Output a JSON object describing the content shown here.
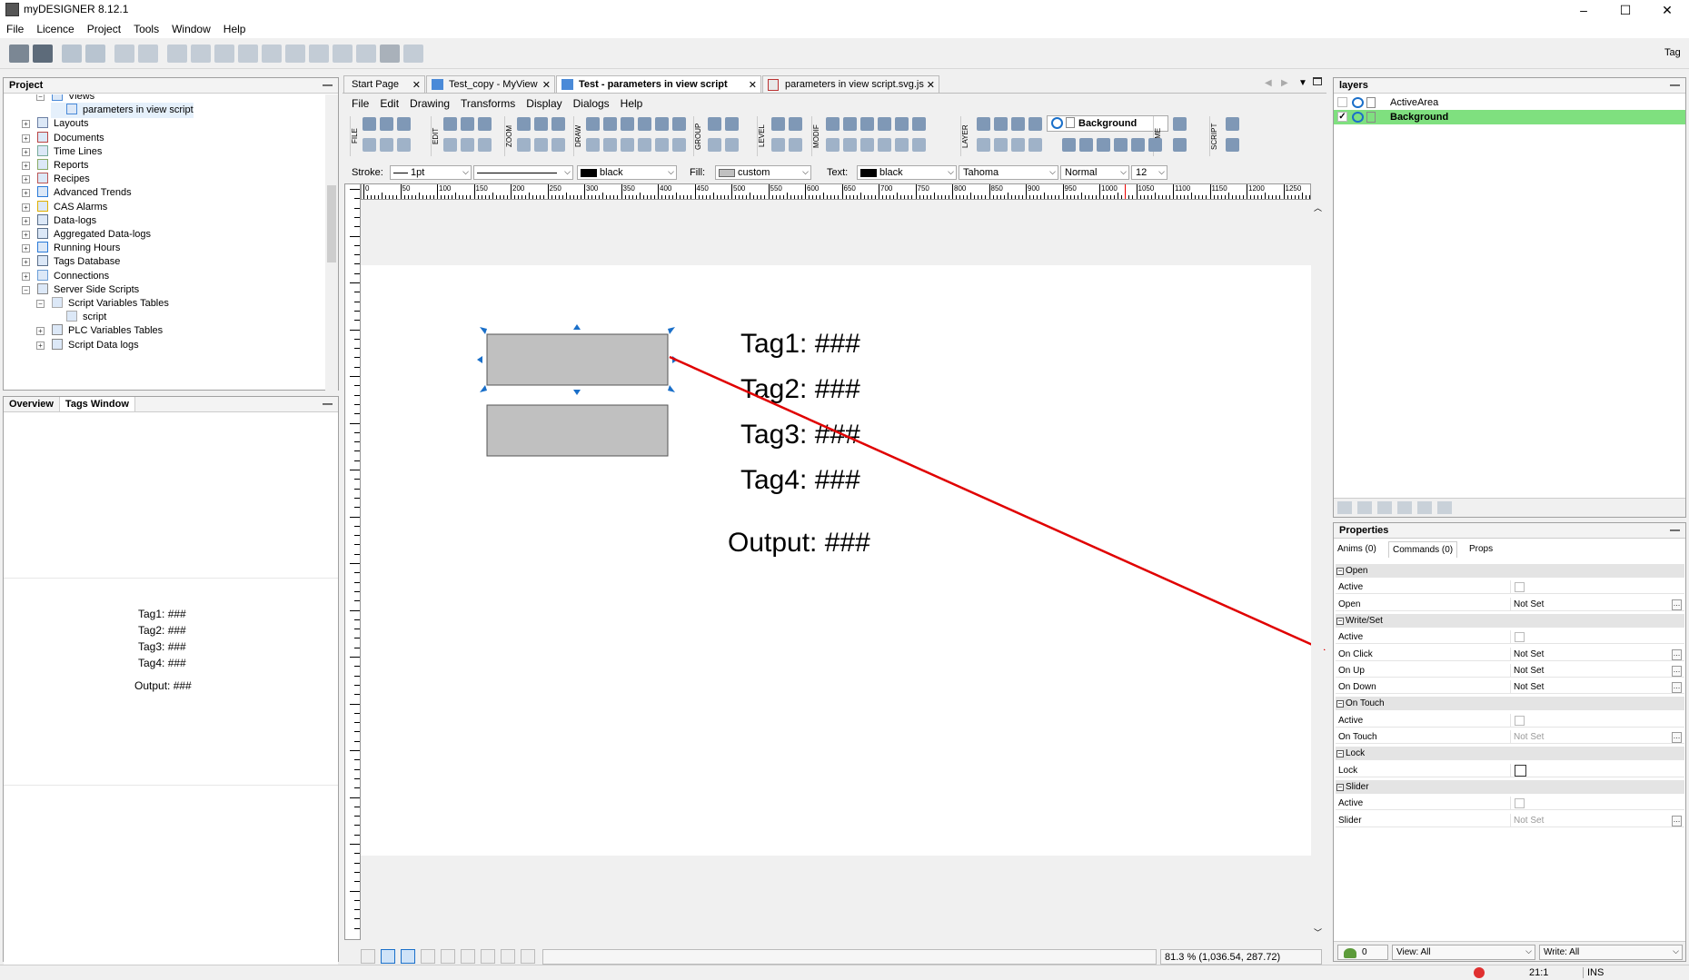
{
  "window": {
    "title": "myDESIGNER 8.12.1",
    "minimize": "–",
    "maximize": "☐",
    "close": "✕"
  },
  "menu": [
    "File",
    "Licence",
    "Project",
    "Tools",
    "Window",
    "Help"
  ],
  "toolbar_right": "Tag",
  "project": {
    "title": "Project",
    "collapse": "—",
    "items": [
      {
        "label": "Views",
        "indent": 2
      },
      {
        "label": "parameters in view script",
        "indent": 3
      },
      {
        "label": "Layouts",
        "indent": 1
      },
      {
        "label": "Documents",
        "indent": 1
      },
      {
        "label": "Time Lines",
        "indent": 1
      },
      {
        "label": "Reports",
        "indent": 1
      },
      {
        "label": "Recipes",
        "indent": 1
      },
      {
        "label": "Advanced Trends",
        "indent": 1
      },
      {
        "label": "CAS Alarms",
        "indent": 1
      },
      {
        "label": "Data-logs",
        "indent": 1
      },
      {
        "label": "Aggregated Data-logs",
        "indent": 1
      },
      {
        "label": "Running Hours",
        "indent": 1
      },
      {
        "label": "Tags Database",
        "indent": 1
      },
      {
        "label": "Connections",
        "indent": 1
      },
      {
        "label": "Server Side Scripts",
        "indent": 1
      },
      {
        "label": "Script Variables Tables",
        "indent": 2
      },
      {
        "label": "script",
        "indent": 3
      },
      {
        "label": "PLC Variables Tables",
        "indent": 2
      },
      {
        "label": "Script Data logs",
        "indent": 2
      }
    ]
  },
  "overview": {
    "tabs": [
      "Overview",
      "Tags Window"
    ],
    "collapse": "—",
    "preview": [
      "Tag1: ###",
      "Tag2: ###",
      "Tag3: ###",
      "Tag4: ###",
      "Output: ###"
    ]
  },
  "doc_tabs": [
    {
      "label": "Start Page",
      "active": false
    },
    {
      "label": "Test_copy - MyView",
      "active": false
    },
    {
      "label": "Test - parameters in view script",
      "active": true
    },
    {
      "label": "parameters in view script.svg.js",
      "active": false
    }
  ],
  "editor_menu": [
    "File",
    "Edit",
    "Drawing",
    "Transforms",
    "Display",
    "Dialogs",
    "Help"
  ],
  "vertical_groups": [
    "FILE",
    "EDIT",
    "ZOOM",
    "DRAW",
    "GROUP",
    "LEVEL",
    "MODIF",
    "LAYER",
    "TIME",
    "SCRIPT"
  ],
  "layer_select": "Background",
  "style_bar": {
    "stroke_label": "Stroke:",
    "stroke_width": "1pt",
    "stroke_color": "black",
    "fill_label": "Fill:",
    "fill_value": "custom",
    "text_label": "Text:",
    "text_color": "black",
    "font": "Tahoma",
    "weight": "Normal",
    "size": "12"
  },
  "ruler_ticks": [
    "0",
    "50",
    "100",
    "150",
    "200",
    "250",
    "300",
    "350",
    "400",
    "450",
    "500",
    "550",
    "600",
    "650",
    "700",
    "750",
    "800",
    "850",
    "900",
    "950",
    "1000",
    "1050",
    "1100",
    "1150",
    "1200",
    "1250"
  ],
  "canvas": {
    "labels": [
      "Tag1: ###",
      "Tag2: ###",
      "Tag3: ###",
      "Tag4: ###"
    ],
    "output": "Output: ###",
    "arrow_color": "#e00000",
    "rect_color": "#c0c0c0"
  },
  "bottom_bar": {
    "zoom": "81.3 %",
    "coords": "(1,036.54, 287.72)"
  },
  "layers": {
    "title": "layers",
    "collapse": "—",
    "items": [
      {
        "name": "ActiveArea",
        "checked": false,
        "selected": false
      },
      {
        "name": "Background",
        "checked": true,
        "selected": true
      }
    ],
    "highlight": "#7fe07f"
  },
  "properties": {
    "title": "Properties",
    "collapse": "—",
    "tabs": [
      "Anims (0)",
      "Commands (0)",
      "Props"
    ],
    "rows": [
      {
        "type": "section",
        "label": "Open"
      },
      {
        "type": "check",
        "label": "Active"
      },
      {
        "type": "value",
        "label": "Open",
        "value": "Not Set"
      },
      {
        "type": "section",
        "label": "Write/Set"
      },
      {
        "type": "check",
        "label": "Active"
      },
      {
        "type": "value",
        "label": "On Click",
        "value": "Not Set"
      },
      {
        "type": "value",
        "label": "On Up",
        "value": "Not Set"
      },
      {
        "type": "value",
        "label": "On Down",
        "value": "Not Set"
      },
      {
        "type": "section",
        "label": "On Touch"
      },
      {
        "type": "check",
        "label": "Active"
      },
      {
        "type": "value",
        "label": "On Touch",
        "value": "Not Set",
        "dim": true
      },
      {
        "type": "section",
        "label": "Lock"
      },
      {
        "type": "check",
        "label": "Lock",
        "strong": true
      },
      {
        "type": "section",
        "label": "Slider"
      },
      {
        "type": "check",
        "label": "Active"
      },
      {
        "type": "value",
        "label": "Slider",
        "value": "Not Set",
        "dim": true
      }
    ],
    "footer": {
      "count": "0",
      "view": "View: All",
      "write": "Write: All"
    }
  },
  "status": {
    "ratio": "21:1",
    "mode": "INS"
  }
}
